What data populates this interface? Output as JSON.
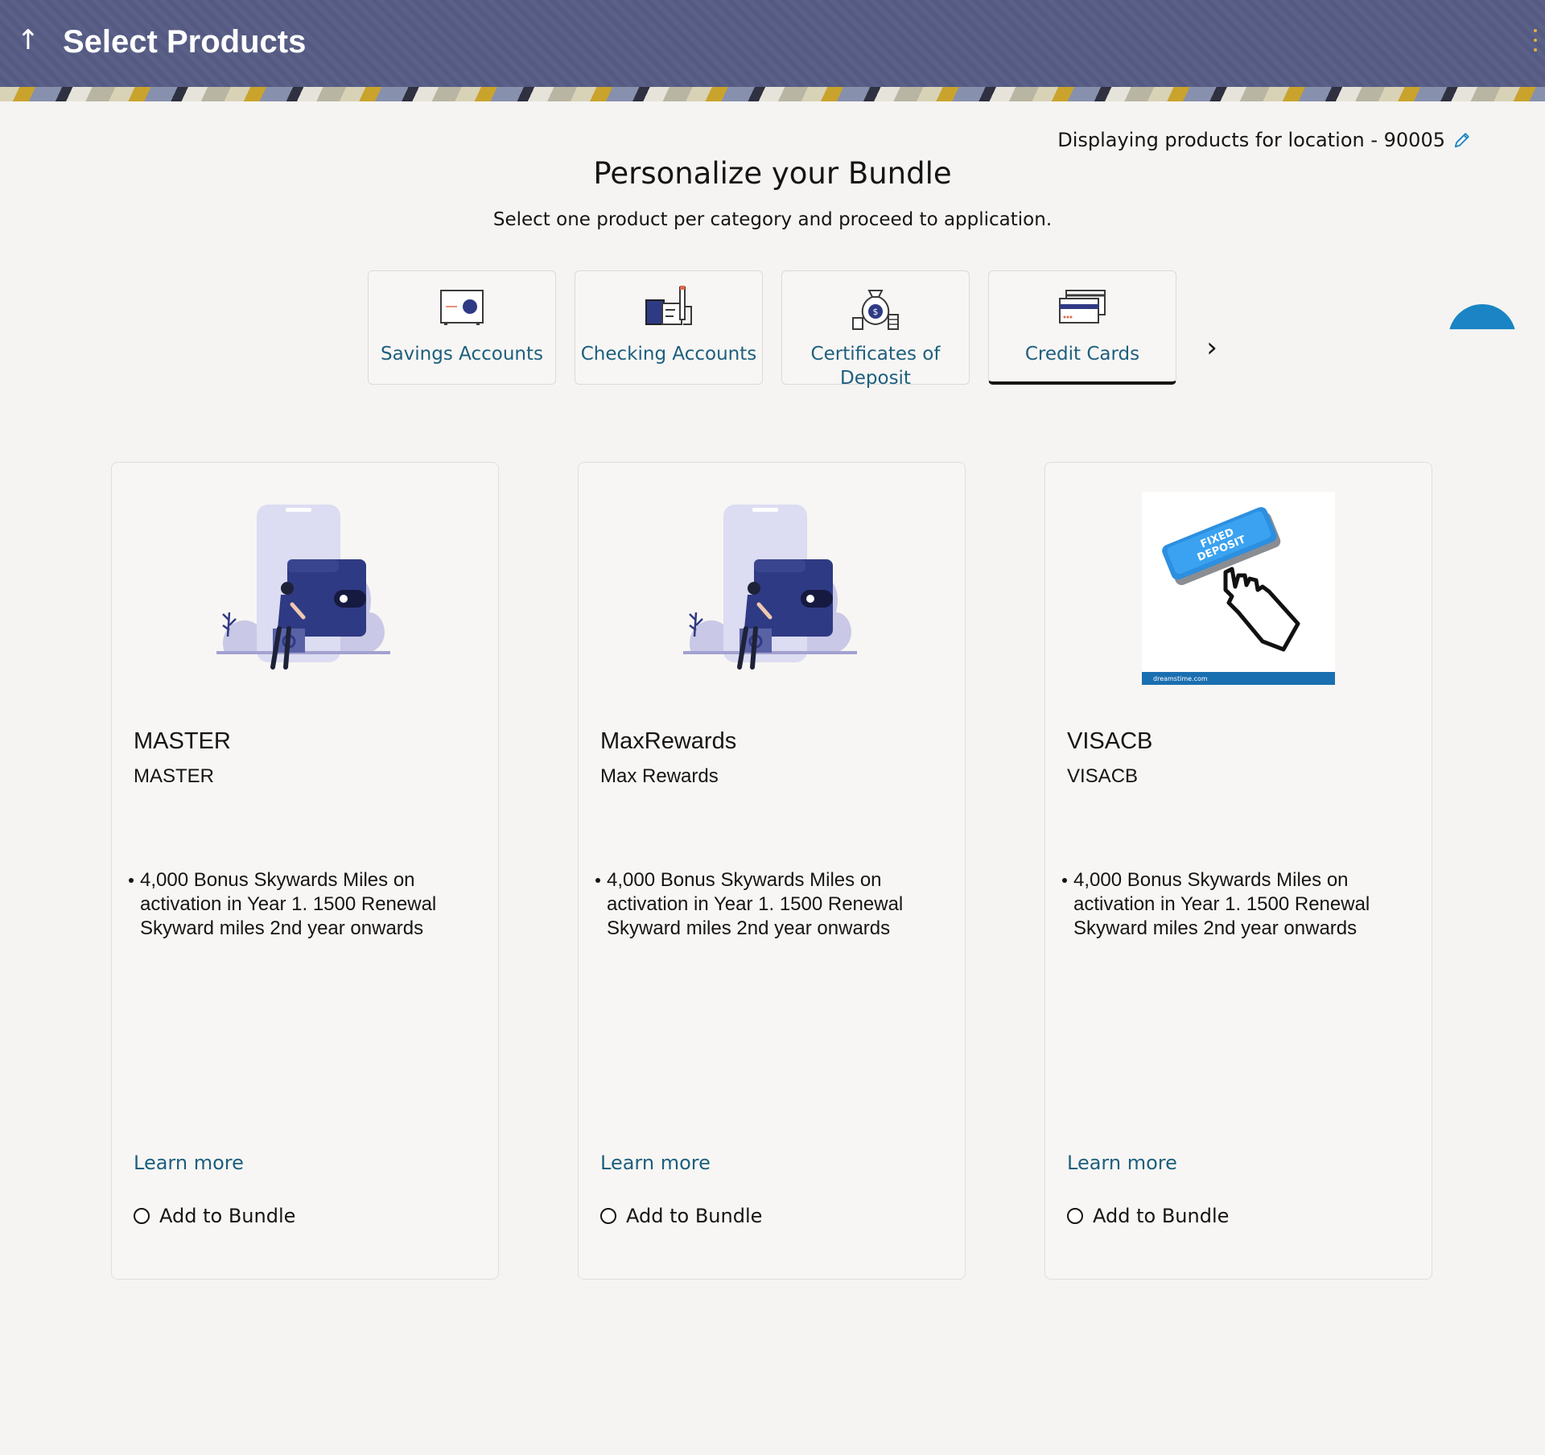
{
  "header": {
    "title": "Select Products",
    "back_icon": "↑",
    "menu_icon": "kebab-menu-icon"
  },
  "location": {
    "text": "Displaying products for location - 90005",
    "edit_icon": "pencil-icon"
  },
  "intro": {
    "title": "Personalize your Bundle",
    "subtitle": "Select one product per category and proceed to application."
  },
  "categories": [
    {
      "label": "Savings Accounts",
      "icon": "safe-icon",
      "active": false
    },
    {
      "label": "Checking Accounts",
      "icon": "checkbook-icon",
      "active": false
    },
    {
      "label": "Certificates of Deposit",
      "icon": "money-bag-icon",
      "active": false
    },
    {
      "label": "Credit Cards",
      "icon": "credit-cards-icon",
      "active": true
    }
  ],
  "next_icon": "›",
  "products": [
    {
      "name": "MASTER",
      "subtitle": "MASTER",
      "feature": "4,000 Bonus Skywards Miles on activation in Year 1. 1500 Renewal Skyward miles 2nd year onwards",
      "learn_more": "Learn more",
      "add_label": "Add to Bundle",
      "image": "wallet-illustration"
    },
    {
      "name": "MaxRewards",
      "subtitle": "Max Rewards",
      "feature": "4,000 Bonus Skywards Miles on activation in Year 1. 1500 Renewal Skyward miles 2nd year onwards",
      "learn_more": "Learn more",
      "add_label": "Add to Bundle",
      "image": "wallet-illustration"
    },
    {
      "name": "VISACB",
      "subtitle": "VISACB",
      "feature": "4,000 Bonus Skywards Miles on activation in Year 1. 1500 Renewal Skyward miles 2nd year onwards",
      "learn_more": "Learn more",
      "add_label": "Add to Bundle",
      "image": "fixed-deposit-button-image",
      "image_text": "FIXED DEPOSIT",
      "image_footer": "dreamstime.com"
    }
  ],
  "colors": {
    "header_bg": "#565c84",
    "link": "#1d5f7e",
    "fab": "#1a84c4",
    "illustration_dark": "#2f3a84",
    "illustration_light": "#c9c8e6"
  }
}
